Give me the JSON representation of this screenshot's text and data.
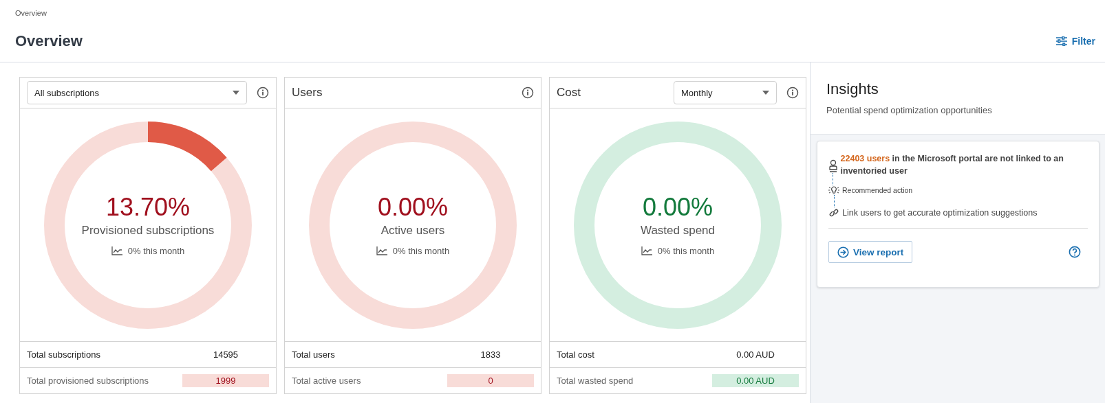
{
  "breadcrumb": "Overview",
  "title": "Overview",
  "filter_button": "Filter",
  "cards": [
    {
      "kind": "select",
      "select_value": "All subscriptions",
      "gauge": {
        "color": "#a0101e",
        "value": "13.70%",
        "label": "Provisioned subscriptions",
        "trend": "0% this month"
      },
      "rows": [
        {
          "label": "Total subscriptions",
          "value": "14595",
          "highlight": false
        },
        {
          "label": "Total provisioned subscriptions",
          "value": "1999",
          "highlight": true
        }
      ]
    },
    {
      "kind": "title",
      "title": "Users",
      "gauge": {
        "color": "#a0101e",
        "value": "0.00%",
        "label": "Active users",
        "trend": "0% this month"
      },
      "rows": [
        {
          "label": "Total users",
          "value": "1833",
          "highlight": false
        },
        {
          "label": "Total active users",
          "value": "0",
          "highlight": true
        }
      ]
    },
    {
      "kind": "title_select",
      "title": "Cost",
      "select_value": "Monthly",
      "gauge": {
        "color": "#137a3c",
        "value": "0.00%",
        "label": "Wasted spend",
        "trend": "0% this month"
      },
      "rows": [
        {
          "label": "Total cost",
          "value": "0.00 AUD",
          "highlight": false
        },
        {
          "label": "Total wasted spend",
          "value": "0.00 AUD",
          "highlight": true
        }
      ]
    }
  ],
  "insights": {
    "title": "Insights",
    "subtitle": "Potential spend optimization opportunities",
    "item": {
      "highlight": "22403 users",
      "text": " in the Microsoft portal are not linked to an inventoried user",
      "step_label": "Recommended action",
      "action": "Link users to get accurate optimization suggestions"
    },
    "button": "View report"
  }
}
